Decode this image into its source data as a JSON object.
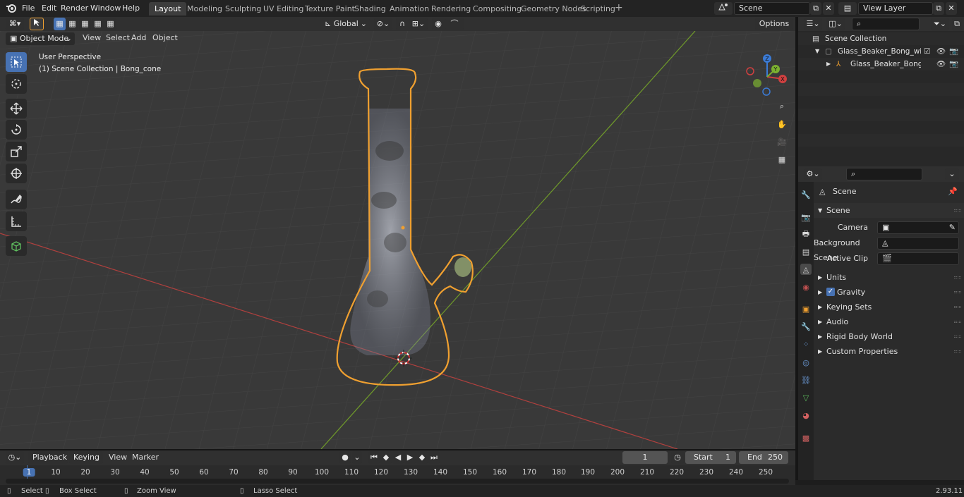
{
  "menu": {
    "items": [
      "File",
      "Edit",
      "Render",
      "Window",
      "Help"
    ]
  },
  "workspaces": [
    "Layout",
    "Modeling",
    "Sculpting",
    "UV Editing",
    "Texture Paint",
    "Shading",
    "Animation",
    "Rendering",
    "Compositing",
    "Geometry Nodes",
    "Scripting"
  ],
  "active_workspace": "Layout",
  "scene_field": "Scene",
  "view_layer_field": "View Layer",
  "viewport_header": {
    "mode": "Object Mode",
    "menus": [
      "View",
      "Select",
      "Add",
      "Object"
    ],
    "transform_orientation": "Global",
    "options_label": "Options"
  },
  "viewport": {
    "perspective_label": "User Perspective",
    "collection_label": "(1) Scene Collection | Bong_cone",
    "gizmo_axes": {
      "x": "X",
      "y": "Y",
      "z": "Z"
    }
  },
  "outliner": {
    "root": "Scene Collection",
    "rows": [
      {
        "label": "Glass_Beaker_Bong_with_Car"
      },
      {
        "label": "Glass_Beaker_Bong_with"
      }
    ]
  },
  "properties": {
    "context_label": "Scene",
    "section_label": "Scene",
    "fields": [
      {
        "label": "Camera"
      },
      {
        "label": "Background Scene"
      },
      {
        "label": "Active Clip"
      }
    ],
    "panels": [
      "Units",
      "Gravity",
      "Keying Sets",
      "Audio",
      "Rigid Body World",
      "Custom Properties"
    ],
    "gravity_checked": true
  },
  "timeline": {
    "menus": [
      "Playback",
      "Keying",
      "View",
      "Marker"
    ],
    "current_frame": "1",
    "start_label": "Start",
    "start_value": "1",
    "end_label": "End",
    "end_value": "250",
    "ruler": [
      "1",
      "10",
      "20",
      "30",
      "40",
      "50",
      "60",
      "70",
      "80",
      "90",
      "100",
      "110",
      "120",
      "130",
      "140",
      "150",
      "160",
      "170",
      "180",
      "190",
      "200",
      "210",
      "220",
      "230",
      "240",
      "250"
    ]
  },
  "statusbar": {
    "items": [
      "Select",
      "Box Select",
      "Zoom View",
      "Lasso Select"
    ],
    "version": "2.93.11"
  },
  "colors": {
    "accent": "#4772b3",
    "selection_outline": "#f0a030",
    "x_axis": "#c0403f",
    "y_axis": "#6f9a2a"
  }
}
